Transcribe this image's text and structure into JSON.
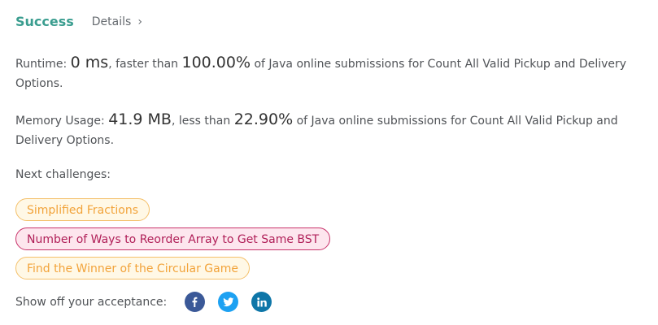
{
  "header": {
    "status": "Success",
    "details_label": "Details",
    "details_chevron": "›"
  },
  "runtime": {
    "label": "Runtime: ",
    "value": "0 ms",
    "comparison": ", faster than ",
    "percent": "100.00%",
    "suffix": " of Java online submissions for Count All Valid Pickup and Delivery Options."
  },
  "memory": {
    "label": "Memory Usage: ",
    "value": "41.9 MB",
    "comparison": ", less than ",
    "percent": "22.90%",
    "suffix": " of Java online submissions for Count All Valid Pickup and Delivery Options."
  },
  "next": {
    "label": "Next challenges:",
    "challenges": [
      {
        "title": "Simplified Fractions",
        "difficulty": "easy"
      },
      {
        "title": "Number of Ways to Reorder Array to Get Same BST",
        "difficulty": "medium"
      },
      {
        "title": "Find the Winner of the Circular Game",
        "difficulty": "easy"
      }
    ]
  },
  "share": {
    "label": "Show off your acceptance:",
    "icons": [
      "facebook-icon",
      "twitter-icon",
      "linkedin-icon"
    ]
  },
  "colors": {
    "success": "#3a9d8f",
    "easy": "#f2a33a",
    "medium": "#b01f58",
    "facebook": "#3b5998",
    "twitter": "#1da1f2",
    "linkedin": "#0e76a8"
  }
}
